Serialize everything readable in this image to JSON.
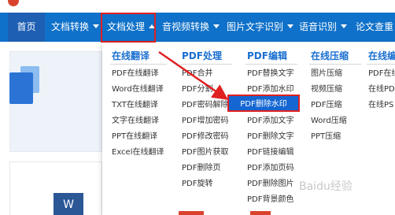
{
  "nav": {
    "items": [
      {
        "label": "首页"
      },
      {
        "label": "文档转换"
      },
      {
        "label": "文档处理"
      },
      {
        "label": "音视频转换"
      },
      {
        "label": "图片文字识别"
      },
      {
        "label": "语音识别"
      },
      {
        "label": "论文查重"
      }
    ]
  },
  "dropdown": {
    "columns": [
      {
        "title": "在线翻译",
        "items": [
          "PDF在线翻译",
          "Word在线翻译",
          "TXT在线翻译",
          "文字在线翻译",
          "PPT在线翻译",
          "Excel在线翻译"
        ]
      },
      {
        "title": "PDF处理",
        "items": [
          "PDF合并",
          "PDF分割",
          "PDF密码解除",
          "PDF增加密码",
          "PDF修改密码",
          "PDF图片获取",
          "PDF删除页",
          "PDF旋转"
        ]
      },
      {
        "title": "PDF编辑",
        "items": [
          "PDF替换文字",
          "PDF添加水印",
          "PDF删除水印",
          "PDF添加文字",
          "PDF删除文字",
          "PDF链接编辑",
          "PDF添加页码",
          "PDF删除图片",
          "PDF背景颜色"
        ]
      },
      {
        "title": "在线压缩",
        "items": [
          "图片压缩",
          "视频压缩",
          "PDF压缩",
          "Word压缩",
          "PPT压缩"
        ]
      },
      {
        "title": "在线编",
        "items": [
          "PDF在线",
          "在线PDF",
          "在线PS"
        ]
      }
    ]
  },
  "left": {
    "word_tile": "W"
  },
  "watermark": "Baidu经验",
  "colors": {
    "nav_bg": "#0f71c9",
    "home_bg": "#1e5fb3",
    "accent": "#1a6fd0",
    "highlight": "#1466d2",
    "annotation_red": "#e02020"
  }
}
